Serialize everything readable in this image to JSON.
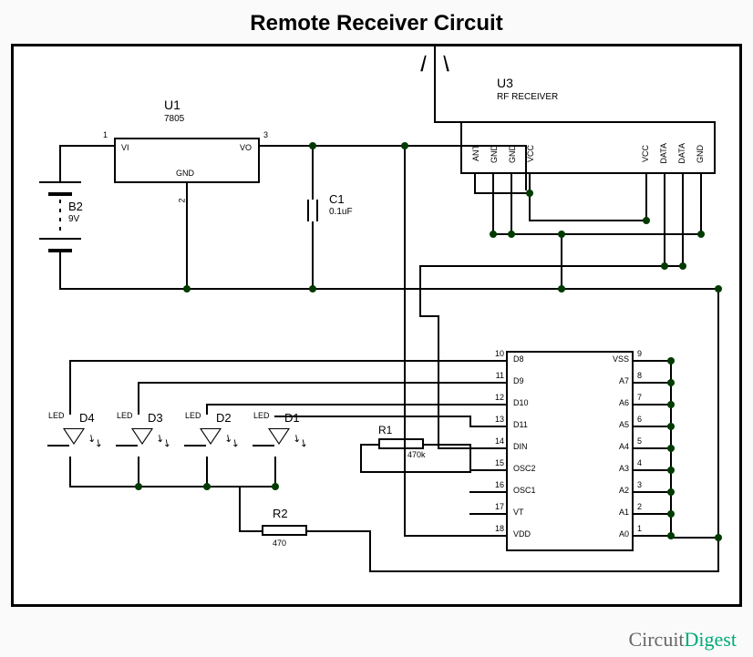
{
  "title": "Remote Receiver Circuit",
  "watermark_a": "Circuit",
  "watermark_b": "Digest",
  "components": {
    "u1": {
      "ref": "U1",
      "value": "7805",
      "pins": {
        "vi": "VI",
        "vo": "VO",
        "gnd": "GND",
        "p1": "1",
        "p2": "2",
        "p3": "3"
      }
    },
    "u3": {
      "ref": "U3",
      "value": "RF RECEIVER",
      "pins": [
        "ANT",
        "GND",
        "GND",
        "VCC",
        "VCC",
        "DATA",
        "DATA",
        "GND"
      ]
    },
    "b2": {
      "ref": "B2",
      "value": "9V"
    },
    "c1": {
      "ref": "C1",
      "value": "0.1uF"
    },
    "r1": {
      "ref": "R1",
      "value": "470k"
    },
    "r2": {
      "ref": "R2",
      "value": "470"
    },
    "leds": [
      "D1",
      "D2",
      "D3",
      "D4"
    ],
    "led_label": "LED",
    "decoder": {
      "left_nums": [
        "10",
        "11",
        "12",
        "13",
        "14",
        "15",
        "16",
        "17",
        "18"
      ],
      "left_labels": [
        "D8",
        "D9",
        "D10",
        "D11",
        "DIN",
        "OSC2",
        "OSC1",
        "VT",
        "VDD"
      ],
      "right_nums": [
        "9",
        "8",
        "7",
        "6",
        "5",
        "4",
        "3",
        "2",
        "1"
      ],
      "right_labels": [
        "VSS",
        "A7",
        "A6",
        "A5",
        "A4",
        "A3",
        "A2",
        "A1",
        "A0"
      ]
    }
  }
}
